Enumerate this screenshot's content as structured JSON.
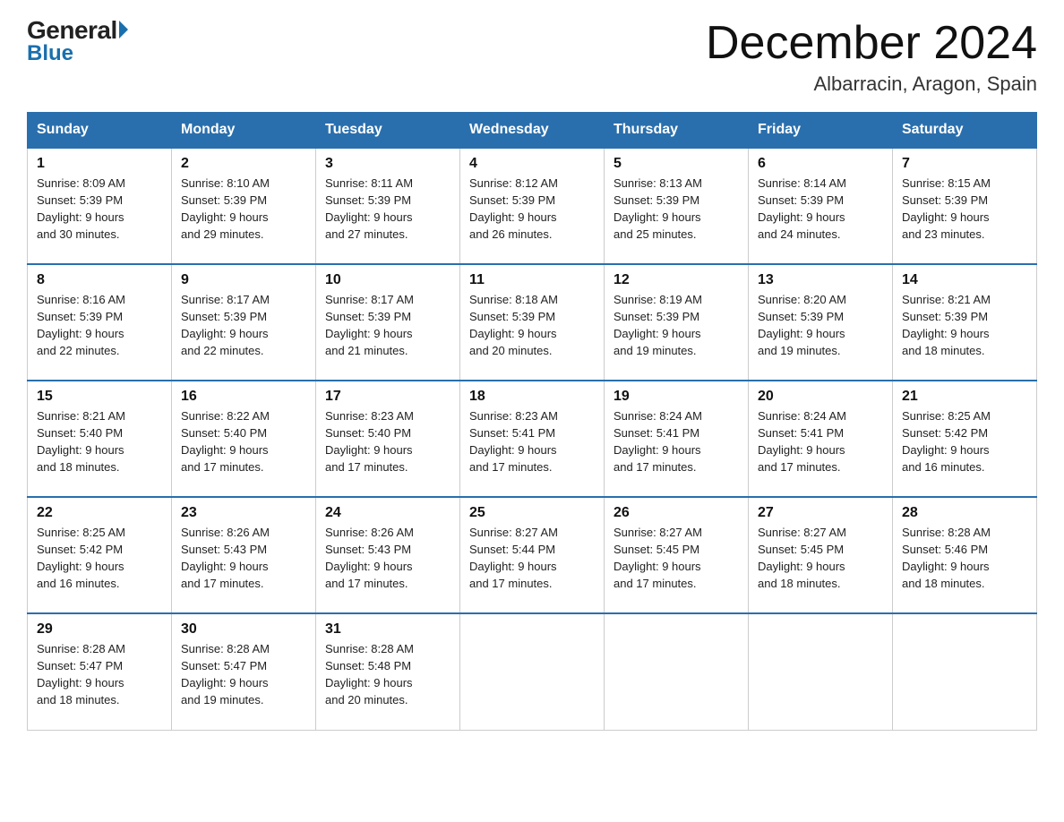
{
  "header": {
    "logo_general": "General",
    "logo_blue": "Blue",
    "month_title": "December 2024",
    "location": "Albarracin, Aragon, Spain"
  },
  "weekdays": [
    "Sunday",
    "Monday",
    "Tuesday",
    "Wednesday",
    "Thursday",
    "Friday",
    "Saturday"
  ],
  "weeks": [
    [
      {
        "day": "1",
        "sunrise": "8:09 AM",
        "sunset": "5:39 PM",
        "daylight": "9 hours and 30 minutes."
      },
      {
        "day": "2",
        "sunrise": "8:10 AM",
        "sunset": "5:39 PM",
        "daylight": "9 hours and 29 minutes."
      },
      {
        "day": "3",
        "sunrise": "8:11 AM",
        "sunset": "5:39 PM",
        "daylight": "9 hours and 27 minutes."
      },
      {
        "day": "4",
        "sunrise": "8:12 AM",
        "sunset": "5:39 PM",
        "daylight": "9 hours and 26 minutes."
      },
      {
        "day": "5",
        "sunrise": "8:13 AM",
        "sunset": "5:39 PM",
        "daylight": "9 hours and 25 minutes."
      },
      {
        "day": "6",
        "sunrise": "8:14 AM",
        "sunset": "5:39 PM",
        "daylight": "9 hours and 24 minutes."
      },
      {
        "day": "7",
        "sunrise": "8:15 AM",
        "sunset": "5:39 PM",
        "daylight": "9 hours and 23 minutes."
      }
    ],
    [
      {
        "day": "8",
        "sunrise": "8:16 AM",
        "sunset": "5:39 PM",
        "daylight": "9 hours and 22 minutes."
      },
      {
        "day": "9",
        "sunrise": "8:17 AM",
        "sunset": "5:39 PM",
        "daylight": "9 hours and 22 minutes."
      },
      {
        "day": "10",
        "sunrise": "8:17 AM",
        "sunset": "5:39 PM",
        "daylight": "9 hours and 21 minutes."
      },
      {
        "day": "11",
        "sunrise": "8:18 AM",
        "sunset": "5:39 PM",
        "daylight": "9 hours and 20 minutes."
      },
      {
        "day": "12",
        "sunrise": "8:19 AM",
        "sunset": "5:39 PM",
        "daylight": "9 hours and 19 minutes."
      },
      {
        "day": "13",
        "sunrise": "8:20 AM",
        "sunset": "5:39 PM",
        "daylight": "9 hours and 19 minutes."
      },
      {
        "day": "14",
        "sunrise": "8:21 AM",
        "sunset": "5:39 PM",
        "daylight": "9 hours and 18 minutes."
      }
    ],
    [
      {
        "day": "15",
        "sunrise": "8:21 AM",
        "sunset": "5:40 PM",
        "daylight": "9 hours and 18 minutes."
      },
      {
        "day": "16",
        "sunrise": "8:22 AM",
        "sunset": "5:40 PM",
        "daylight": "9 hours and 17 minutes."
      },
      {
        "day": "17",
        "sunrise": "8:23 AM",
        "sunset": "5:40 PM",
        "daylight": "9 hours and 17 minutes."
      },
      {
        "day": "18",
        "sunrise": "8:23 AM",
        "sunset": "5:41 PM",
        "daylight": "9 hours and 17 minutes."
      },
      {
        "day": "19",
        "sunrise": "8:24 AM",
        "sunset": "5:41 PM",
        "daylight": "9 hours and 17 minutes."
      },
      {
        "day": "20",
        "sunrise": "8:24 AM",
        "sunset": "5:41 PM",
        "daylight": "9 hours and 17 minutes."
      },
      {
        "day": "21",
        "sunrise": "8:25 AM",
        "sunset": "5:42 PM",
        "daylight": "9 hours and 16 minutes."
      }
    ],
    [
      {
        "day": "22",
        "sunrise": "8:25 AM",
        "sunset": "5:42 PM",
        "daylight": "9 hours and 16 minutes."
      },
      {
        "day": "23",
        "sunrise": "8:26 AM",
        "sunset": "5:43 PM",
        "daylight": "9 hours and 17 minutes."
      },
      {
        "day": "24",
        "sunrise": "8:26 AM",
        "sunset": "5:43 PM",
        "daylight": "9 hours and 17 minutes."
      },
      {
        "day": "25",
        "sunrise": "8:27 AM",
        "sunset": "5:44 PM",
        "daylight": "9 hours and 17 minutes."
      },
      {
        "day": "26",
        "sunrise": "8:27 AM",
        "sunset": "5:45 PM",
        "daylight": "9 hours and 17 minutes."
      },
      {
        "day": "27",
        "sunrise": "8:27 AM",
        "sunset": "5:45 PM",
        "daylight": "9 hours and 18 minutes."
      },
      {
        "day": "28",
        "sunrise": "8:28 AM",
        "sunset": "5:46 PM",
        "daylight": "9 hours and 18 minutes."
      }
    ],
    [
      {
        "day": "29",
        "sunrise": "8:28 AM",
        "sunset": "5:47 PM",
        "daylight": "9 hours and 18 minutes."
      },
      {
        "day": "30",
        "sunrise": "8:28 AM",
        "sunset": "5:47 PM",
        "daylight": "9 hours and 19 minutes."
      },
      {
        "day": "31",
        "sunrise": "8:28 AM",
        "sunset": "5:48 PM",
        "daylight": "9 hours and 20 minutes."
      },
      null,
      null,
      null,
      null
    ]
  ],
  "labels": {
    "sunrise": "Sunrise:",
    "sunset": "Sunset:",
    "daylight": "Daylight:"
  }
}
